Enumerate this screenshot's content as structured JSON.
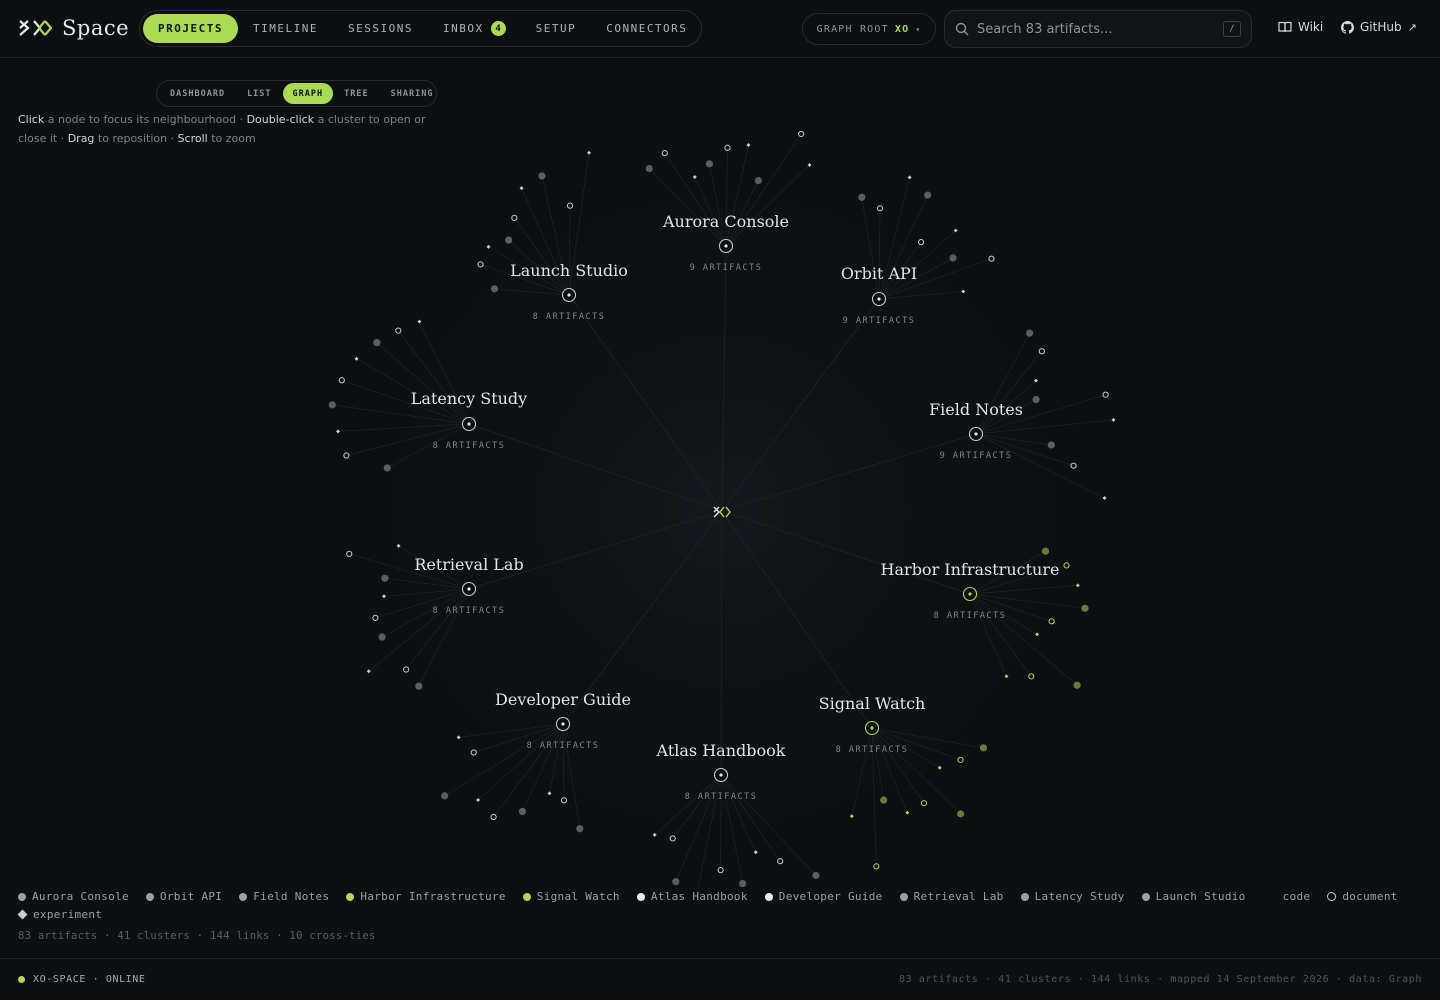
{
  "app": {
    "name": "Space"
  },
  "nav": {
    "items": [
      {
        "label": "PROJECTS",
        "active": true
      },
      {
        "label": "TIMELINE"
      },
      {
        "label": "SESSIONS"
      },
      {
        "label": "INBOX",
        "badge": "4"
      },
      {
        "label": "SETUP"
      },
      {
        "label": "CONNECTORS"
      }
    ]
  },
  "graph_root": {
    "label": "GRAPH ROOT",
    "value": "XO"
  },
  "search": {
    "placeholder": "Search 83 artifacts...",
    "shortcut": "/"
  },
  "links": {
    "wiki": "Wiki",
    "github": "GitHub"
  },
  "views": {
    "items": [
      {
        "label": "DASHBOARD"
      },
      {
        "label": "LIST"
      },
      {
        "label": "GRAPH",
        "active": true
      },
      {
        "label": "TREE"
      },
      {
        "label": "SHARING"
      }
    ]
  },
  "hint": {
    "click": "Click",
    "click_text": " a node to focus its neighbourhood · ",
    "dblclick": "Double-click",
    "dblclick_text": " a cluster to open or close it · ",
    "drag": "Drag",
    "drag_text": " to reposition · ",
    "scroll": "Scroll",
    "scroll_text": " to zoom"
  },
  "graph": {
    "root_label": "XO",
    "clusters": [
      {
        "name": "Aurora Console",
        "count": "9 ARTIFACTS",
        "accent": false
      },
      {
        "name": "Orbit API",
        "count": "9 ARTIFACTS",
        "accent": false
      },
      {
        "name": "Field Notes",
        "count": "9 ARTIFACTS",
        "accent": false
      },
      {
        "name": "Harbor Infrastructure",
        "count": "8 ARTIFACTS",
        "accent": true
      },
      {
        "name": "Signal Watch",
        "count": "8 ARTIFACTS",
        "accent": true
      },
      {
        "name": "Atlas Handbook",
        "count": "8 ARTIFACTS",
        "accent": false
      },
      {
        "name": "Developer Guide",
        "count": "8 ARTIFACTS",
        "accent": false
      },
      {
        "name": "Retrieval Lab",
        "count": "8 ARTIFACTS",
        "accent": false
      },
      {
        "name": "Latency Study",
        "count": "8 ARTIFACTS",
        "accent": false
      },
      {
        "name": "Launch Studio",
        "count": "8 ARTIFACTS",
        "accent": false
      }
    ]
  },
  "legend": {
    "clusters": [
      {
        "label": "Aurora Console",
        "color": "#9aa0a6"
      },
      {
        "label": "Orbit API",
        "color": "#9aa0a6"
      },
      {
        "label": "Field Notes",
        "color": "#9aa0a6"
      },
      {
        "label": "Harbor Infrastructure",
        "color": "#a9dc52"
      },
      {
        "label": "Signal Watch",
        "color": "#a9dc52"
      },
      {
        "label": "Atlas Handbook",
        "color": "#e6e8ea"
      },
      {
        "label": "Developer Guide",
        "color": "#e6e8ea"
      },
      {
        "label": "Retrieval Lab",
        "color": "#9aa0a6"
      },
      {
        "label": "Latency Study",
        "color": "#9aa0a6"
      },
      {
        "label": "Launch Studio",
        "color": "#9aa0a6"
      }
    ],
    "types": [
      {
        "label": "code",
        "shape": "dot"
      },
      {
        "label": "document",
        "shape": "ring"
      },
      {
        "label": "experiment",
        "shape": "diamond"
      }
    ]
  },
  "stats": "83 artifacts · 41 clusters · 144 links · 10 cross-ties",
  "footer": {
    "status": "XO-SPACE · ONLINE",
    "meta": "83 artifacts · 41 clusters · 144 links · mapped 14 September 2026 · data: Graph"
  },
  "colors": {
    "accent": "#a9dc52",
    "background": "#0d0f11",
    "node": "#9aa0a6"
  }
}
